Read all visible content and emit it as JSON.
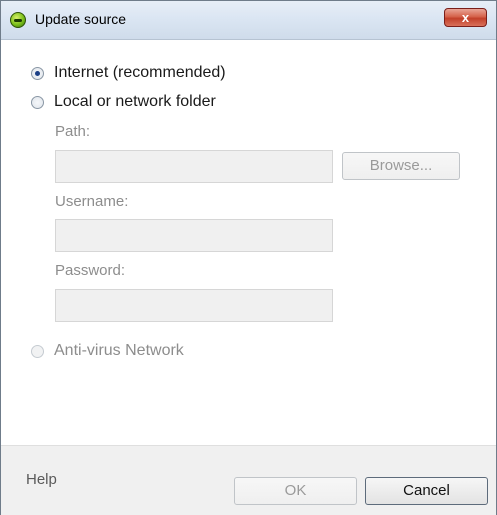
{
  "window": {
    "title": "Update source",
    "close_label": "x"
  },
  "options": {
    "internet_label": "Internet (recommended)",
    "local_label": "Local or network folder",
    "antivirus_label": "Anti-virus Network"
  },
  "fields": {
    "path_label": "Path:",
    "path_value": "",
    "browse_label": "Browse...",
    "username_label": "Username:",
    "username_value": "",
    "password_label": "Password:",
    "password_value": ""
  },
  "footer": {
    "help_label": "Help",
    "ok_label": "OK",
    "cancel_label": "Cancel"
  },
  "colors": {
    "titlebar": "#dbe6f3",
    "close": "#c2402a",
    "disabled_text": "#8d8d8d"
  }
}
